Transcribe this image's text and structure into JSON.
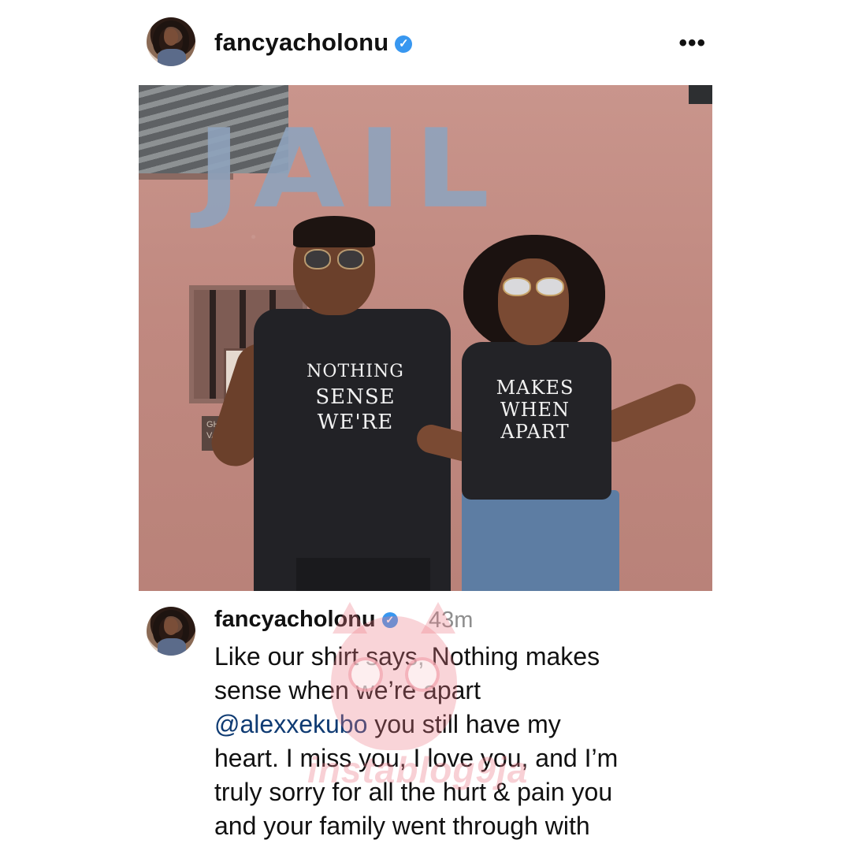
{
  "post": {
    "username": "fancyacholonu",
    "more_icon": "more-horizontal-icon",
    "verified_icon": "verified-badge-icon"
  },
  "photo": {
    "wall_text": "JAIL",
    "man_shirt": [
      "NOTHING",
      "SENSE",
      "WE'RE"
    ],
    "woman_shirt": [
      "MAKES",
      "WHEN",
      "APART"
    ],
    "plaque_text": [
      "GHO",
      "VAR"
    ]
  },
  "caption": {
    "username": "fancyacholonu",
    "time": "43m",
    "line1": "Like our shirt says, Nothing makes",
    "line2": "sense when we’re apart",
    "mention": "@alexxekubo",
    "line3_rest": " you still have my",
    "line4": "heart. I miss you, I love you, and I’m",
    "line5": "truly sorry for all the hurt & pain you",
    "line6": "and your family went through with"
  },
  "watermark": {
    "text": "instablog9ja",
    "color": "#eb7887"
  },
  "colors": {
    "verified": "#3897f0",
    "mention": "#0f3b73",
    "timestamp": "#8e8e8e"
  }
}
